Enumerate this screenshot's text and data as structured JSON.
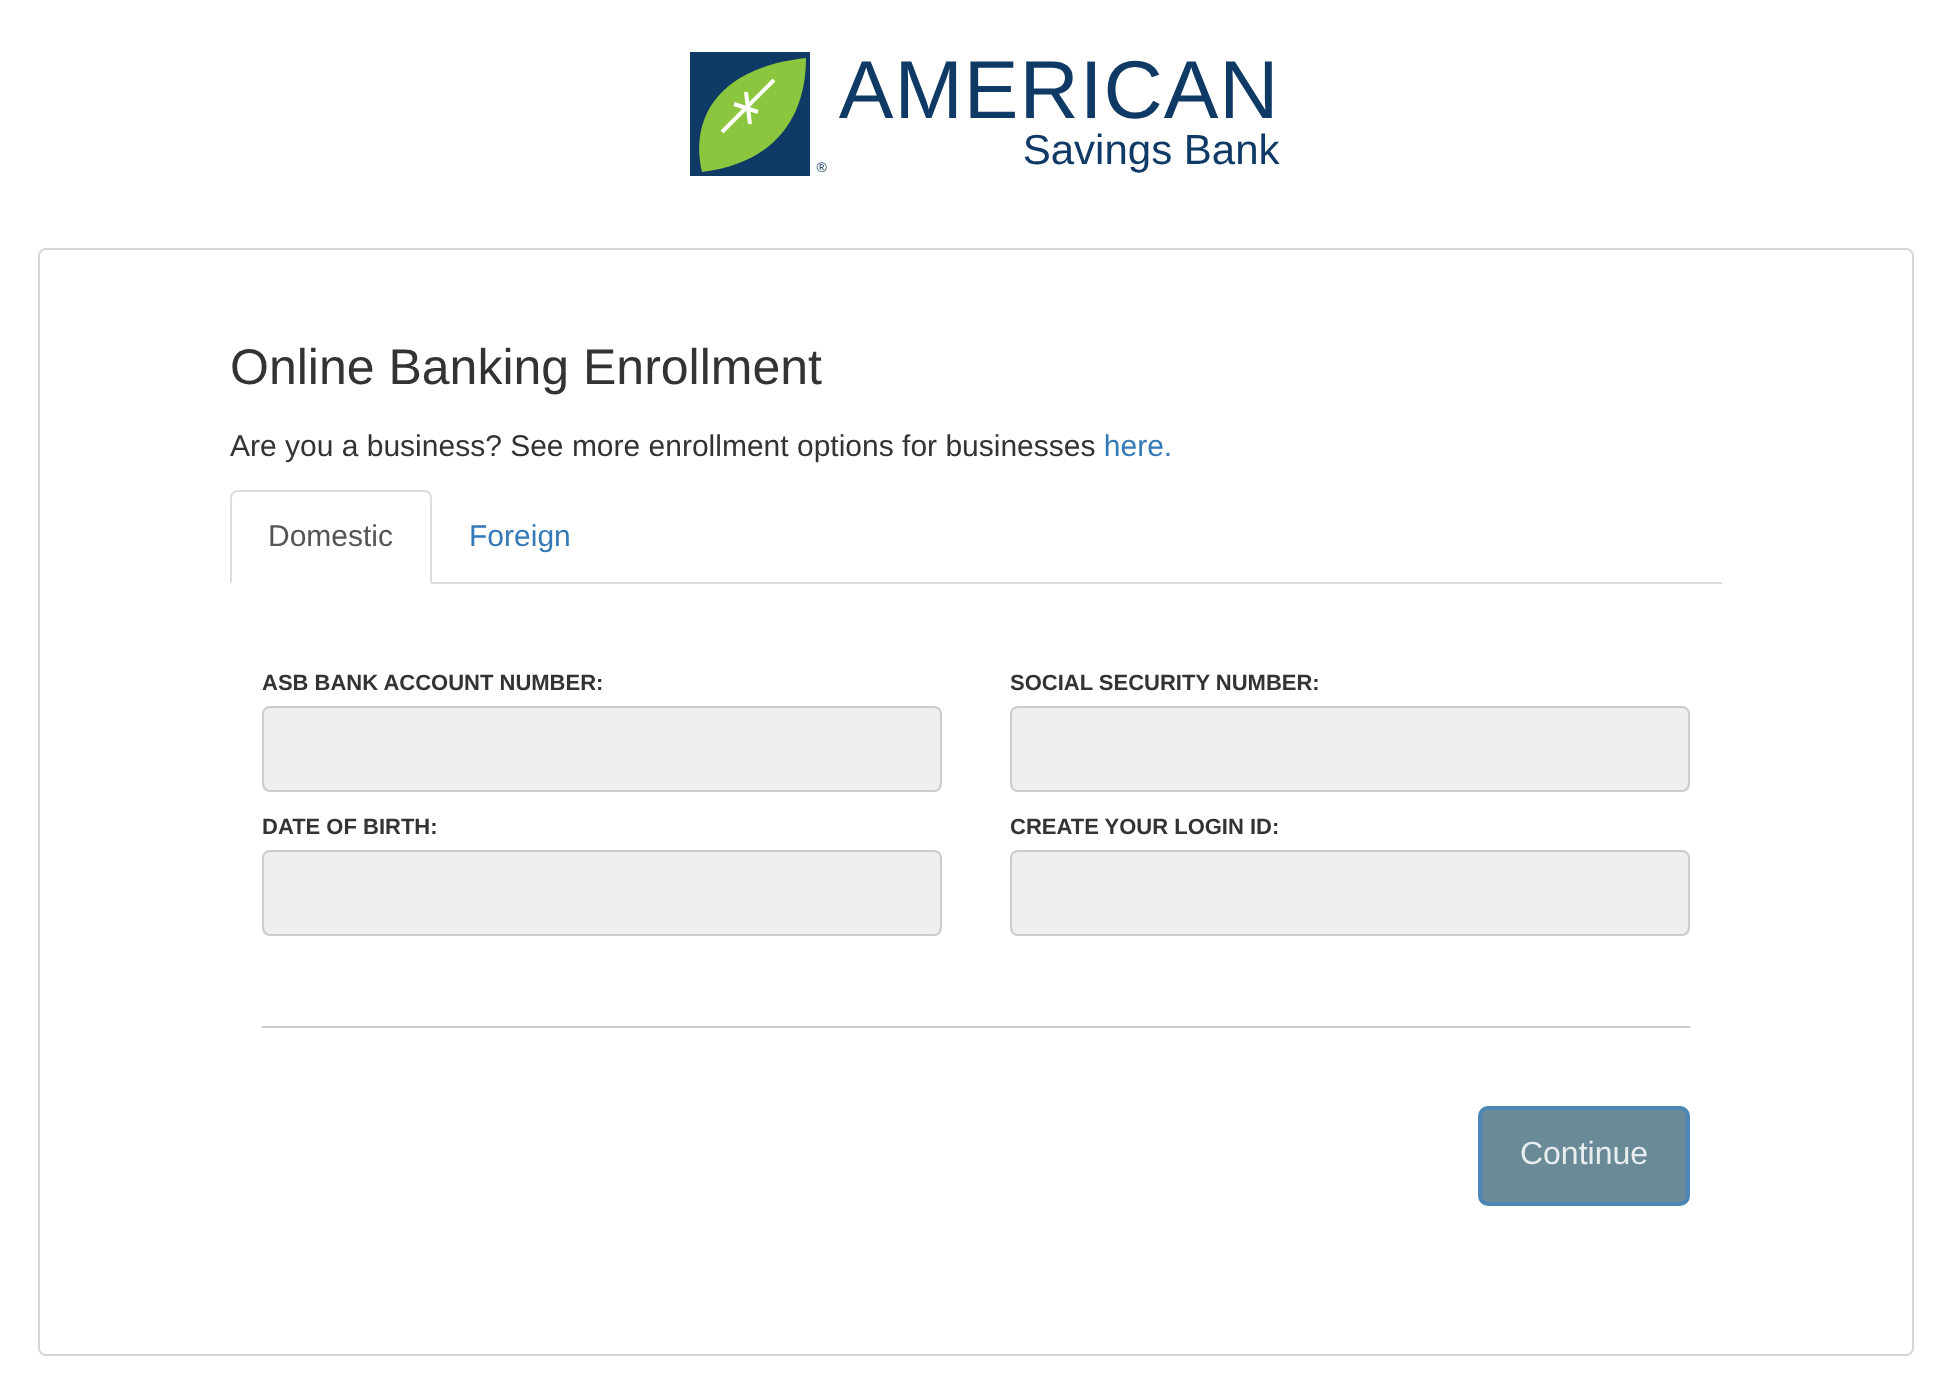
{
  "logo": {
    "name": "AMERICAN",
    "tagline": "Savings Bank",
    "mark": "®"
  },
  "title": "Online Banking Enrollment",
  "intro": {
    "text": "Are you a business? See more enrollment options for businesses",
    "link": "here."
  },
  "tabs": [
    {
      "label": "Domestic",
      "selected": true
    },
    {
      "label": "Foreign",
      "selected": false
    }
  ],
  "fields": [
    {
      "label": "ASB BANK ACCOUNT NUMBER:"
    },
    {
      "label": "SOCIAL SECURITY NUMBER:"
    },
    {
      "label": "DATE OF BIRTH:"
    },
    {
      "label": "CREATE YOUR LOGIN ID:"
    }
  ],
  "continue_button": {
    "label": "Continue",
    "disabled": true
  }
}
